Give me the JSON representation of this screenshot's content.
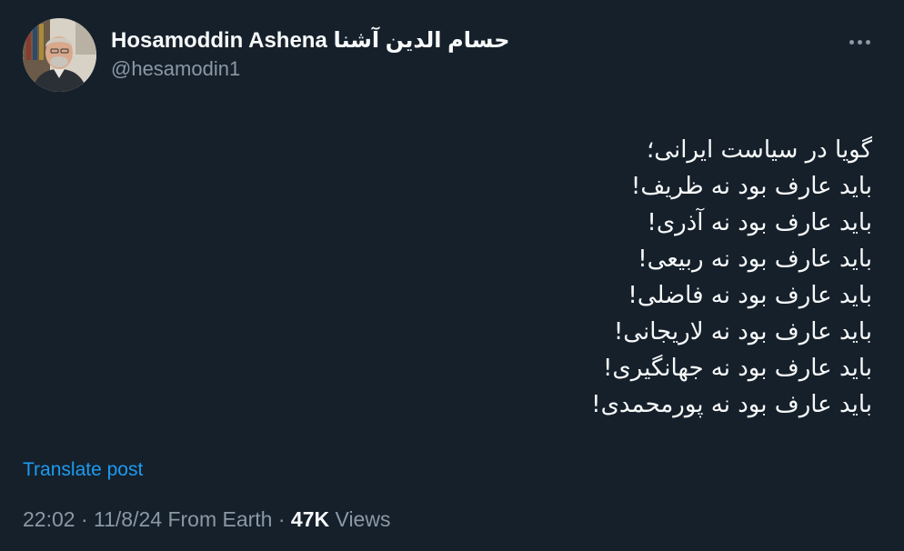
{
  "author": {
    "display_name": "Hosamoddin Ashena",
    "display_name_fa": "حسام الدین آشنا",
    "handle": "@hesamodin1"
  },
  "more_icon": "more-horizontal-icon",
  "tweet_lines": [
    "گویا در سیاست ایرانی؛",
    "باید عارف بود نه ظریف!",
    "باید عارف بود نه آذری!",
    "باید عارف بود نه ربیعی!",
    "باید عارف بود نه فاضلی!",
    "باید عارف بود نه لاریجانی!",
    "باید عارف بود نه جهانگیری!",
    "باید عارف بود نه پورمحمدی!"
  ],
  "translate_label": "Translate post",
  "meta": {
    "time": "22:02",
    "sep1": " · ",
    "date": "11/8/24",
    "source": "From Earth",
    "sep2": " · ",
    "views_count": "47K",
    "views_label": "Views"
  },
  "colors": {
    "background": "#15202b",
    "primary_text": "#f7f9f9",
    "secondary_text": "#8b98a5",
    "link": "#1d9bf0"
  }
}
